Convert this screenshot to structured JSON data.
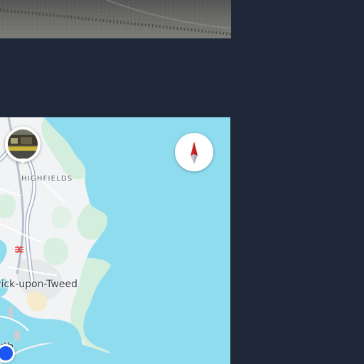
{
  "photo_panel": {
    "description_icon": "street-photo"
  },
  "map": {
    "labels": {
      "highfields": "HIGHFIELDS",
      "town": "wick-upon-Tweed",
      "south": "uth"
    },
    "colors": {
      "water": "#8fdcef",
      "land": "#f1f3f4",
      "green": "#d4eedd",
      "road": "#a9b4c8",
      "accent_location": "#1a57f0",
      "compass_north": "#d32b2b"
    },
    "icons": {
      "compass": "compass-icon",
      "rail": "railway-station-icon",
      "location": "current-location-icon",
      "photo_pin": "photo-pin-icon"
    }
  },
  "background": "#1e2838"
}
